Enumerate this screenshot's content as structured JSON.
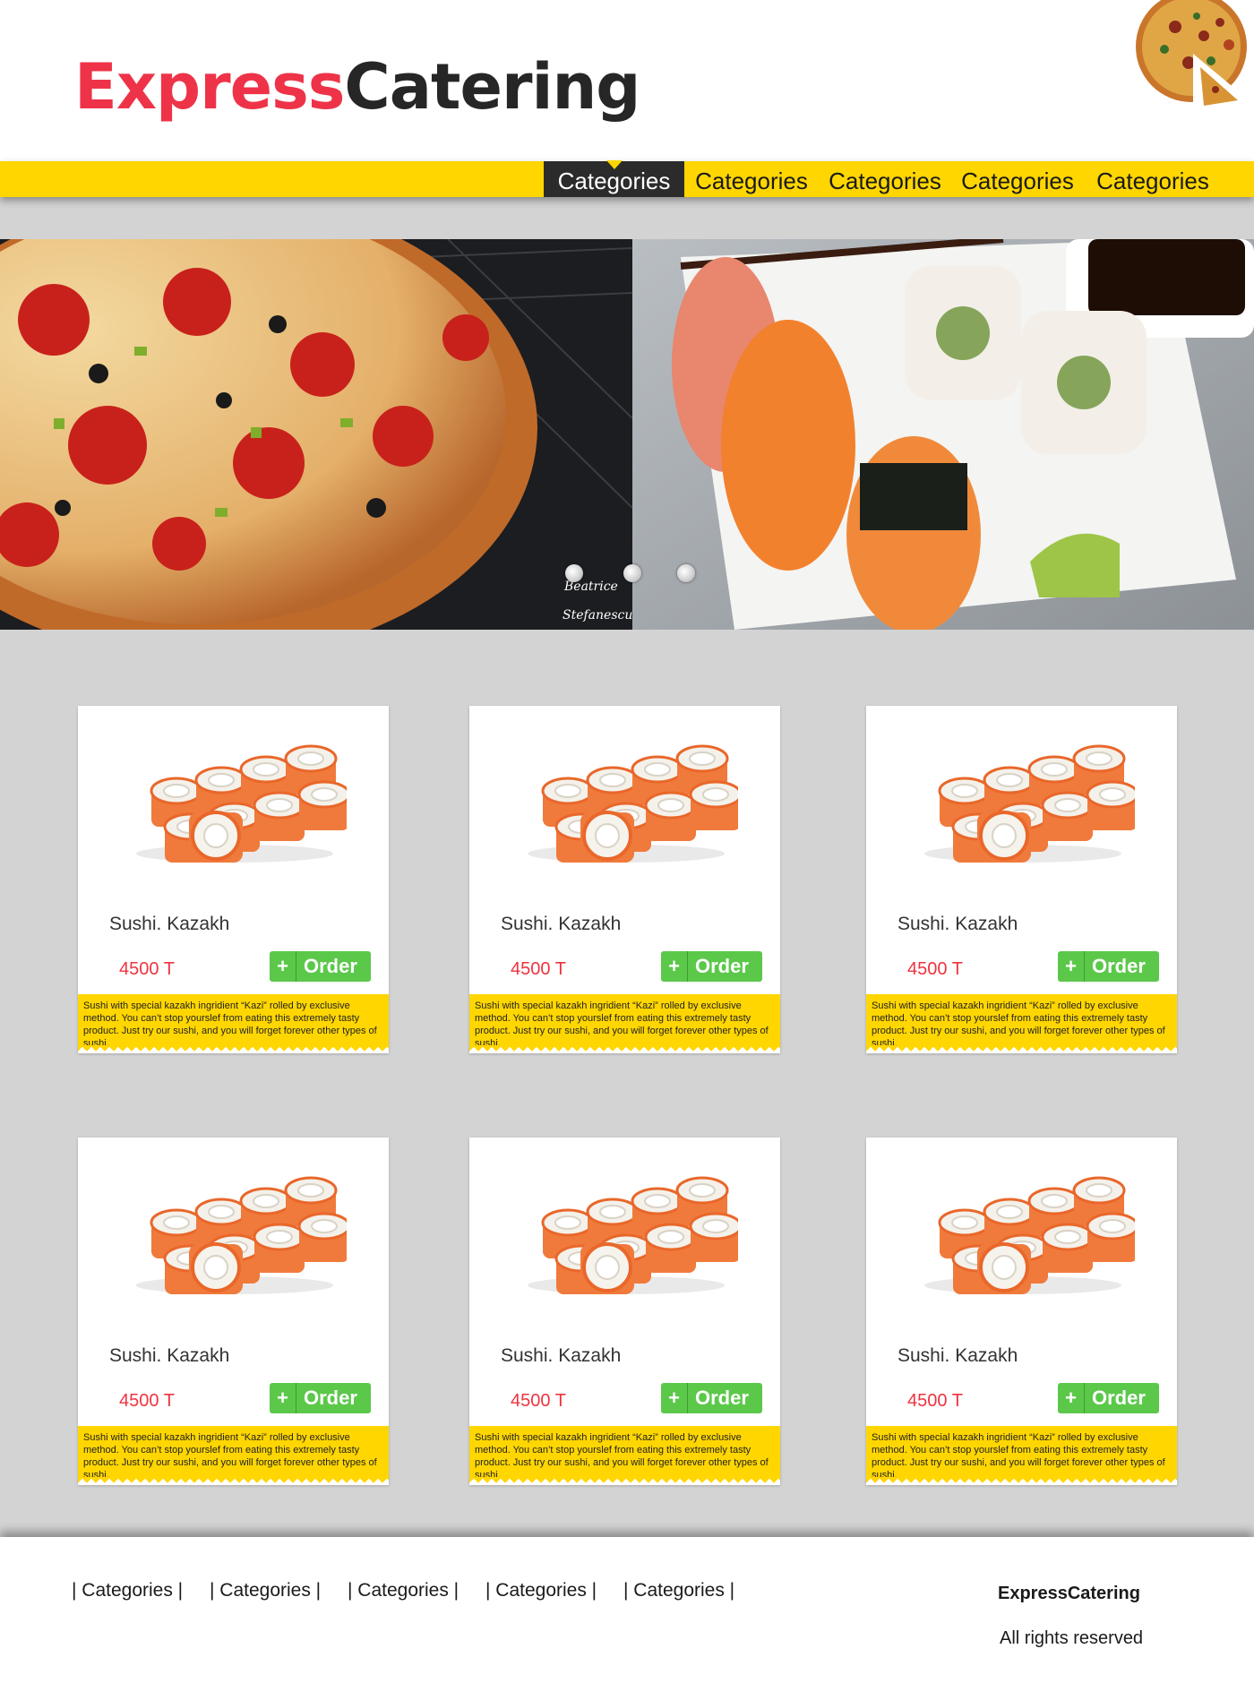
{
  "header": {
    "logo_part1": "Express",
    "logo_part2": "Catering"
  },
  "nav": {
    "items": [
      "Categories",
      "Categories",
      "Categories",
      "Categories",
      "Categories"
    ],
    "active_index": 0
  },
  "hero": {
    "slides": 3,
    "active_slide": 0,
    "image_caption": "Beatrice Stefanescu"
  },
  "products": [
    {
      "name": "Sushi. Kazakh",
      "price": "4500 T",
      "order_label": "Order",
      "description": "Sushi with special kazakh ingridient “Kazi” rolled by exclusive method. You can’t stop yourslef from eating this extremely tasty product. Just try our sushi, and you will forget forever other types of sushi."
    },
    {
      "name": "Sushi. Kazakh",
      "price": "4500 T",
      "order_label": "Order",
      "description": "Sushi with special kazakh ingridient “Kazi” rolled by exclusive method. You can’t stop yourslef from eating this extremely tasty product. Just try our sushi, and you will forget forever other types of sushi."
    },
    {
      "name": "Sushi. Kazakh",
      "price": "4500 T",
      "order_label": "Order",
      "description": "Sushi with special kazakh ingridient “Kazi” rolled by exclusive method. You can’t stop yourslef from eating this extremely tasty product. Just try our sushi, and you will forget forever other types of sushi."
    },
    {
      "name": "Sushi. Kazakh",
      "price": "4500 T",
      "order_label": "Order",
      "description": "Sushi with special kazakh ingridient “Kazi” rolled by exclusive method. You can’t stop yourslef from eating this extremely tasty product. Just try our sushi, and you will forget forever other types of sushi."
    },
    {
      "name": "Sushi. Kazakh",
      "price": "4500 T",
      "order_label": "Order",
      "description": "Sushi with special kazakh ingridient “Kazi” rolled by exclusive method. You can’t stop yourslef from eating this extremely tasty product. Just try our sushi, and you will forget forever other types of sushi."
    },
    {
      "name": "Sushi. Kazakh",
      "price": "4500 T",
      "order_label": "Order",
      "description": "Sushi with special kazakh ingridient “Kazi” rolled by exclusive method. You can’t stop yourslef from eating this extremely tasty product. Just try our sushi, and you will forget forever other types of sushi."
    }
  ],
  "footer": {
    "links": [
      "| Categories |",
      "| Categories |",
      "| Categories |",
      "| Categories |",
      "| Categories |"
    ],
    "brand": "ExpressCatering",
    "rights": "All rights reserved"
  },
  "colors": {
    "accent_yellow": "#ffd600",
    "brand_red": "#ee3348",
    "order_green": "#5bc84a",
    "price_red": "#ee3340"
  }
}
